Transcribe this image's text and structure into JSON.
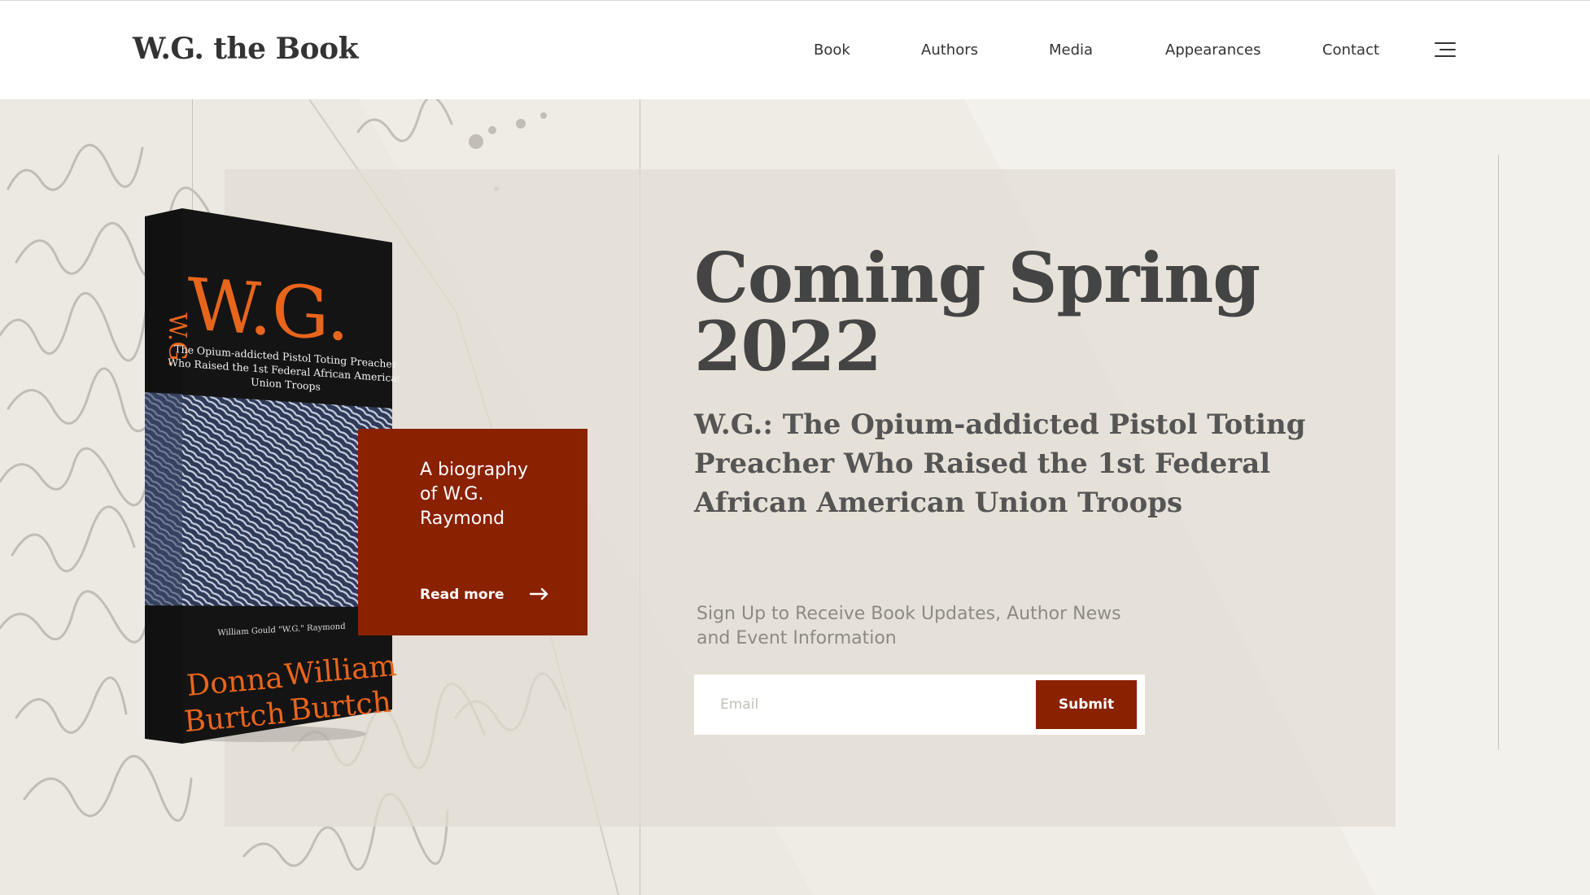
{
  "header": {
    "brand": "W.G. the Book",
    "nav": [
      {
        "label": "Book"
      },
      {
        "label": "Authors"
      },
      {
        "label": "Media"
      },
      {
        "label": "Appearances"
      },
      {
        "label": "Contact"
      }
    ],
    "menu_icon": "hamburger-menu-icon"
  },
  "book": {
    "spine_title": "W.G.",
    "cover_title": "W.G.",
    "cover_subtitle_lines": [
      "The Opium-addicted Pistol Toting Preacher",
      "Who Raised the 1st Federal African American",
      "Union Troops"
    ],
    "cover_subject": "William Gould \"W.G.\" Raymond",
    "author_1_first": "Donna",
    "author_1_last": "Burtch",
    "author_2_first": "William",
    "author_2_last": "Burtch"
  },
  "card": {
    "text": "A biography of W.G. Raymond",
    "link": "Read more",
    "arrow_icon": "arrow-right-icon"
  },
  "hero": {
    "title": "Coming Spring 2022",
    "subtitle": "W.G.: The Opium-addicted Pistol Toting Preacher Who Raised the 1st Federal African American Union Troops"
  },
  "signup": {
    "text": "Sign Up to Receive Book Updates, Author News and Event Information",
    "email_placeholder": "Email",
    "submit_label": "Submit"
  },
  "colors": {
    "accent": "#8a2101",
    "background": "#efece5",
    "panel": "#e2ddd3",
    "cover_orange": "#e8651c"
  }
}
